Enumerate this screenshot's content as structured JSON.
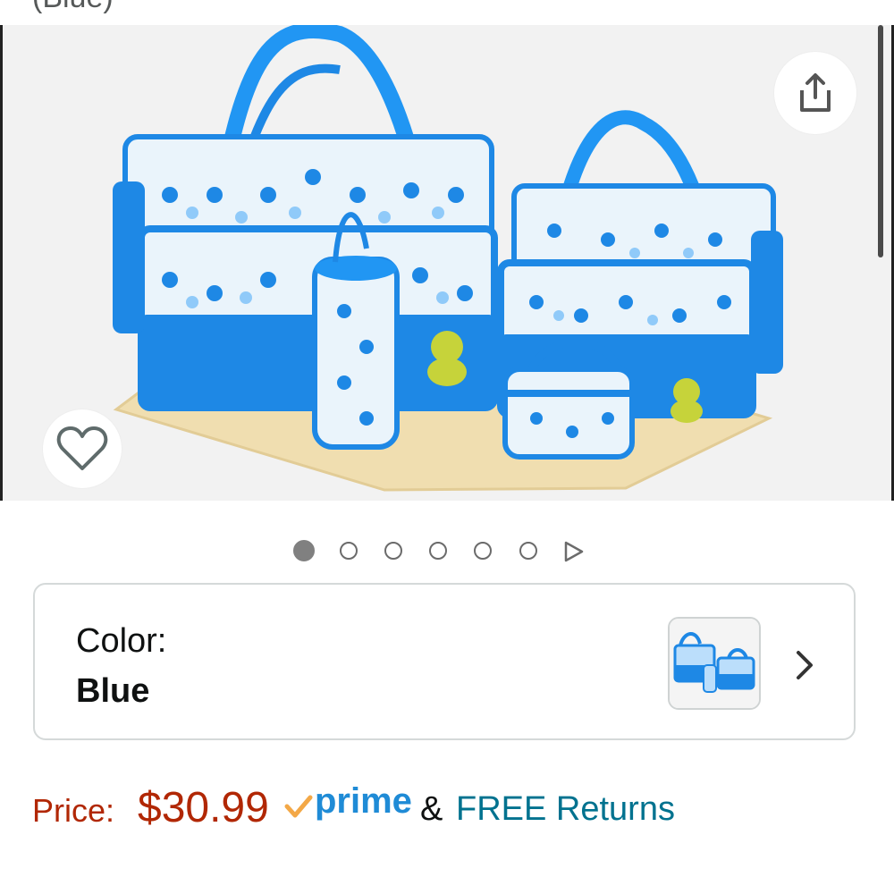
{
  "header": {
    "clipped_title_text": "(Blue)"
  },
  "gallery": {
    "share_icon": "share-icon",
    "wishlist_icon": "heart-outline-icon",
    "image_count_dots": 6,
    "active_index": 1,
    "play_icon": "play-triangle-icon"
  },
  "variation": {
    "label": "Color:",
    "value": "Blue",
    "chevron_icon": "chevron-right-icon"
  },
  "pricing": {
    "label": "Price:",
    "value": "$30.99",
    "prime_word": "prime",
    "prime_check_icon": "prime-check-icon",
    "ampersand": "&",
    "returns_text": "FREE Returns"
  },
  "colors": {
    "price": "#b12704",
    "prime_blue": "#1f8bd6",
    "prime_check": "#f3a847",
    "returns_teal": "#00728f",
    "bag_blue": "#1e88e5"
  }
}
